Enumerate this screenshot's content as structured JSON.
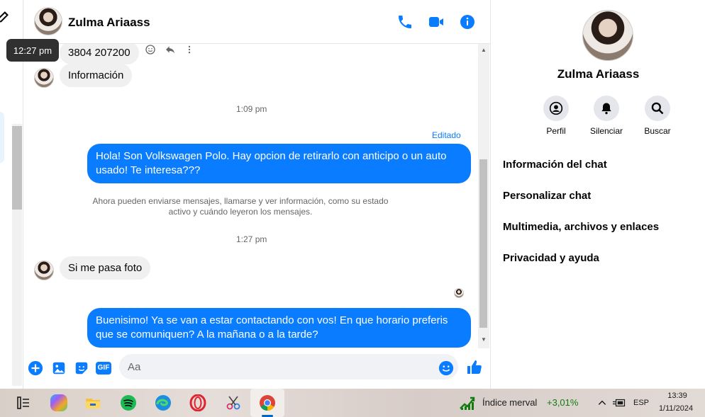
{
  "header": {
    "contact_name": "Zulma Ariaass"
  },
  "tooltip": {
    "time": "12:27 pm"
  },
  "messages": {
    "phone_msg": "3804 207200",
    "info_msg": "Información",
    "time_1": "1:09 pm",
    "edited_label": "Editado",
    "out_msg_1": "Hola! Son Volkswagen Polo. Hay opcion de retirarlo con anticipo o un auto usado! Te interesa???",
    "system_note_line1": "Ahora pueden enviarse mensajes, llamarse y ver información, como su estado",
    "system_note_line2": "activo y cuándo leyeron los mensajes.",
    "time_2": "1:27 pm",
    "in_msg_photo": "Si me pasa foto",
    "out_msg_2": "Buenisimo! Ya se van a estar contactando con vos! En que horario preferis que se comuniquen? A la mañana o a la tarde?"
  },
  "composer": {
    "placeholder": "Aa",
    "gif_label": "GIF"
  },
  "profile": {
    "name": "Zulma Ariaass",
    "actions": [
      {
        "label": "Perfil",
        "icon": "user-icon"
      },
      {
        "label": "Silenciar",
        "icon": "bell-icon"
      },
      {
        "label": "Buscar",
        "icon": "search-icon"
      }
    ],
    "sections": [
      "Información del chat",
      "Personalizar chat",
      "Multimedia, archivos y enlaces",
      "Privacidad y ayuda"
    ]
  },
  "taskbar": {
    "widget_label": "Índice merval",
    "widget_value": "+3,01%",
    "language": "ESP",
    "time": "13:39",
    "date": "1/11/2024",
    "accent": "#0067c0"
  },
  "colors": {
    "messenger_blue": "#0a7cff",
    "in_bubble": "#f0f0f0"
  }
}
